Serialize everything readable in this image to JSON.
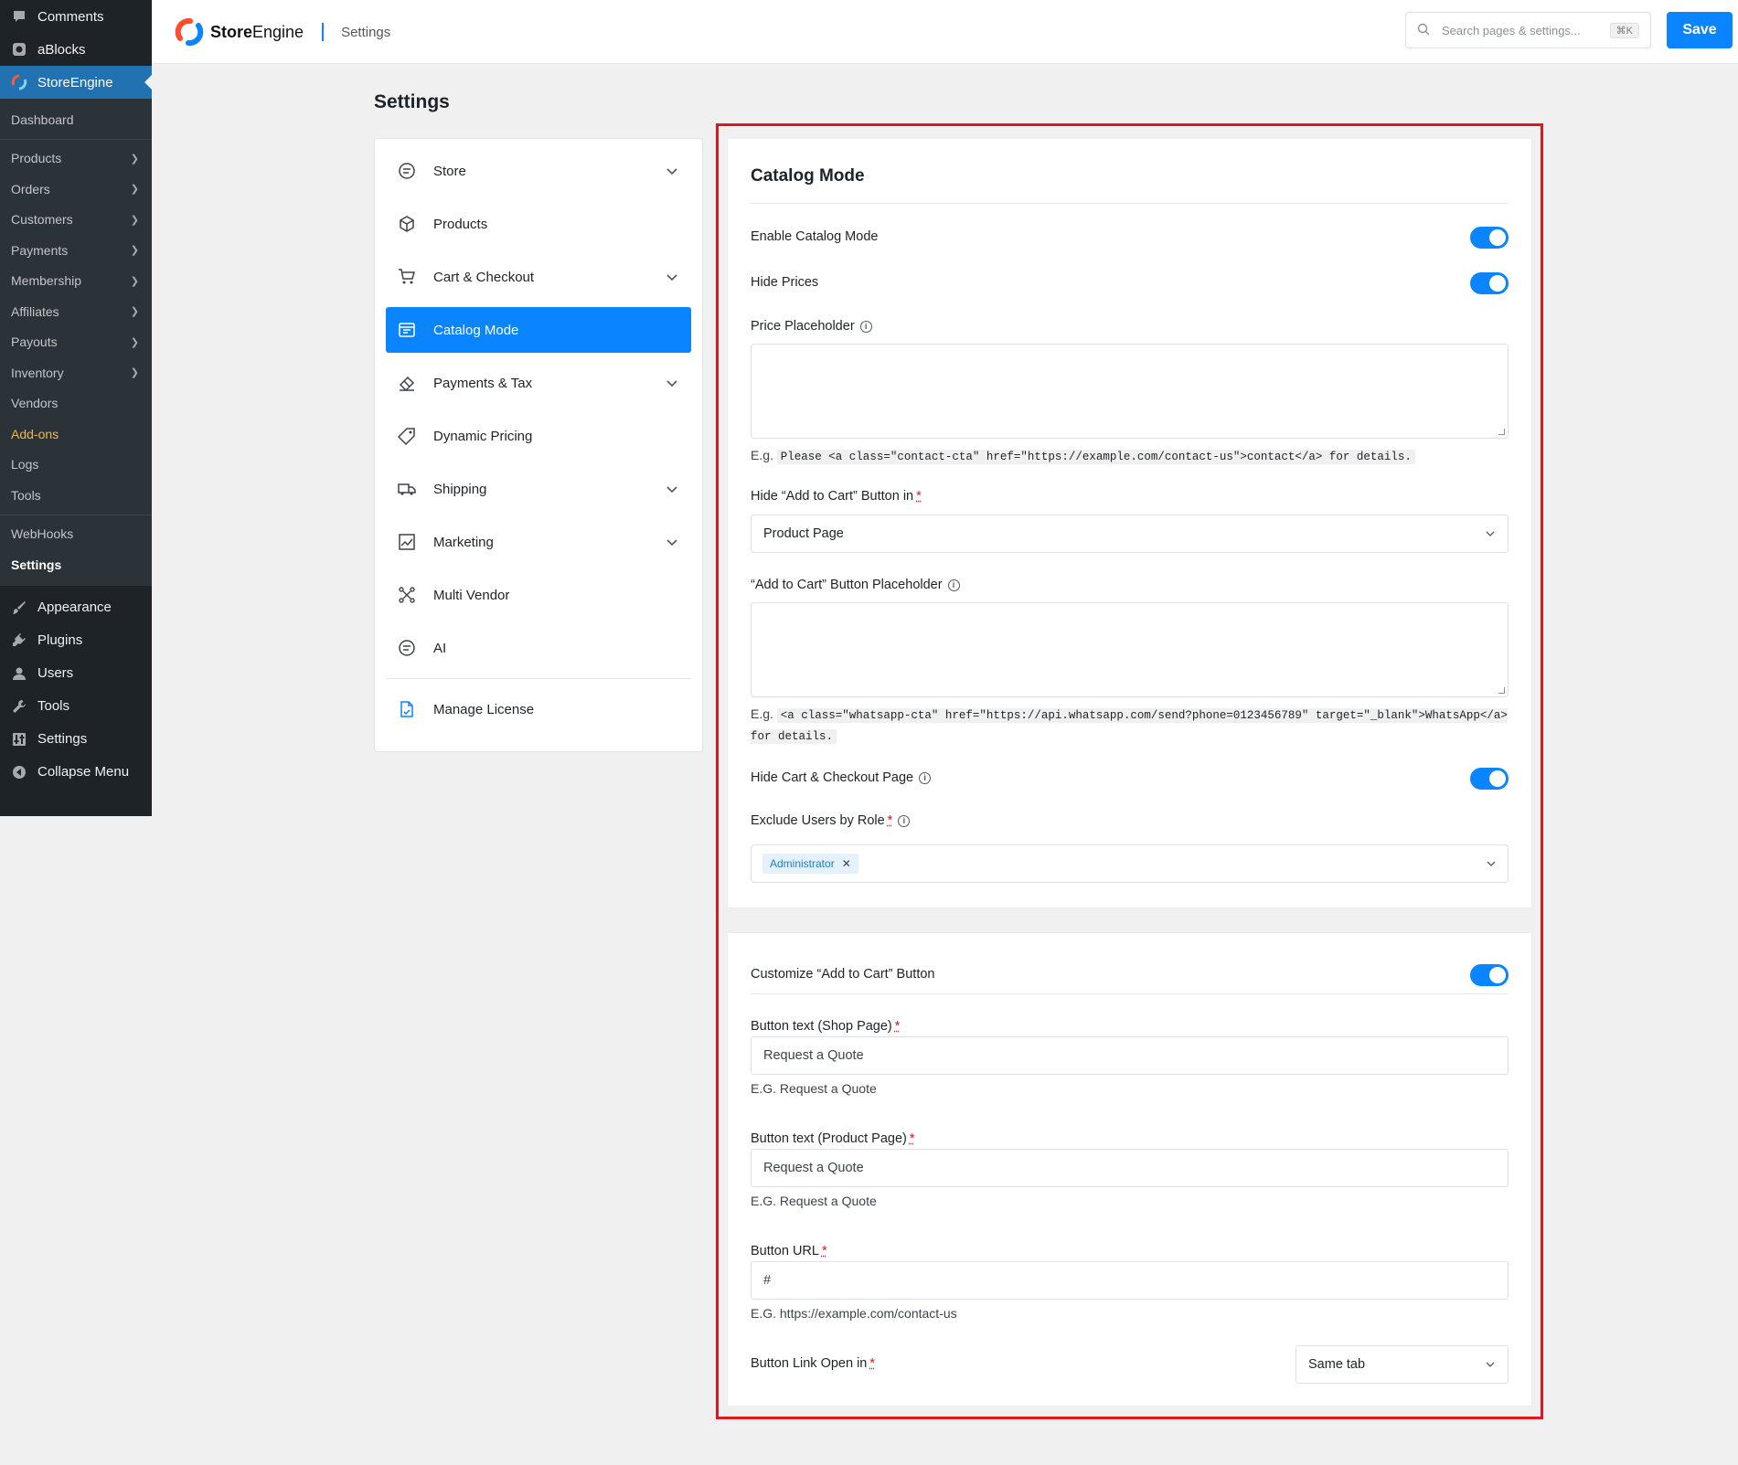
{
  "wp_menu": {
    "comments": "Comments",
    "ablocks": "aBlocks",
    "storeengine": "StoreEngine",
    "sub": [
      {
        "label": "Dashboard",
        "chevron": false
      },
      {
        "label": "Products",
        "chevron": true
      },
      {
        "label": "Orders",
        "chevron": true
      },
      {
        "label": "Customers",
        "chevron": true
      },
      {
        "label": "Payments",
        "chevron": true
      },
      {
        "label": "Membership",
        "chevron": true
      },
      {
        "label": "Affiliates",
        "chevron": true
      },
      {
        "label": "Payouts",
        "chevron": true
      },
      {
        "label": "Inventory",
        "chevron": true
      },
      {
        "label": "Vendors",
        "chevron": false
      },
      {
        "label": "Add-ons",
        "chevron": false
      },
      {
        "label": "Logs",
        "chevron": false
      },
      {
        "label": "Tools",
        "chevron": false
      },
      {
        "label": "WebHooks",
        "chevron": false
      },
      {
        "label": "Settings",
        "chevron": false
      }
    ],
    "bottom": [
      "Appearance",
      "Plugins",
      "Users",
      "Tools",
      "Settings",
      "Collapse Menu"
    ]
  },
  "header": {
    "brand_bold": "Store",
    "brand_rest": "Engine",
    "page": "Settings",
    "search_placeholder": "Search pages & settings...",
    "search_shortcut": "⌘K",
    "save_label": "Save"
  },
  "page_title": "Settings",
  "settings_nav": [
    {
      "label": "Store",
      "icon": "store-icon",
      "expandable": true
    },
    {
      "label": "Products",
      "icon": "box-icon",
      "expandable": false
    },
    {
      "label": "Cart & Checkout",
      "icon": "cart-icon",
      "expandable": true
    },
    {
      "label": "Catalog Mode",
      "icon": "catalog-icon",
      "expandable": false,
      "active": true
    },
    {
      "label": "Payments & Tax",
      "icon": "payments-icon",
      "expandable": true
    },
    {
      "label": "Dynamic Pricing",
      "icon": "tag-icon",
      "expandable": false
    },
    {
      "label": "Shipping",
      "icon": "truck-icon",
      "expandable": true
    },
    {
      "label": "Marketing",
      "icon": "chart-icon",
      "expandable": true
    },
    {
      "label": "Multi Vendor",
      "icon": "network-icon",
      "expandable": false
    },
    {
      "label": "AI",
      "icon": "ai-icon",
      "expandable": false
    }
  ],
  "manage_license": "Manage License",
  "catalog": {
    "title": "Catalog Mode",
    "enable_label": "Enable Catalog Mode",
    "enable_on": true,
    "hide_prices_label": "Hide Prices",
    "hide_prices_on": true,
    "price_placeholder_label": "Price Placeholder",
    "price_placeholder_value": "",
    "price_hint_prefix": "E.g.",
    "price_hint_code": "Please <a class=\"contact-cta\" href=\"https://example.com/contact-us\">contact</a> for details.",
    "hide_atc_label": "Hide “Add to Cart” Button in",
    "hide_atc_value": "Product Page",
    "atc_placeholder_label": "“Add to Cart” Button Placeholder",
    "atc_placeholder_value": "",
    "atc_hint_prefix": "E.g.",
    "atc_hint_code": "<a class=\"whatsapp-cta\" href=\"https://api.whatsapp.com/send?phone=0123456789\" target=\"_blank\">WhatsApp</a> for details.",
    "hide_cart_label": "Hide Cart & Checkout Page",
    "hide_cart_on": true,
    "exclude_label": "Exclude Users by Role",
    "exclude_tag": "Administrator",
    "required_mark": "*",
    "info_mark": "i"
  },
  "customize": {
    "toggle_label": "Customize “Add to Cart” Button",
    "toggle_on": true,
    "shop_label": "Button text (Shop Page)",
    "shop_value": "Request a Quote",
    "shop_hint": "E.G. Request a Quote",
    "product_label": "Button text (Product Page)",
    "product_value": "Request a Quote",
    "product_hint": "E.G. Request a Quote",
    "url_label": "Button URL",
    "url_value": "#",
    "url_hint": "E.G. https://example.com/contact-us",
    "open_label": "Button Link Open in",
    "open_value": "Same tab"
  }
}
